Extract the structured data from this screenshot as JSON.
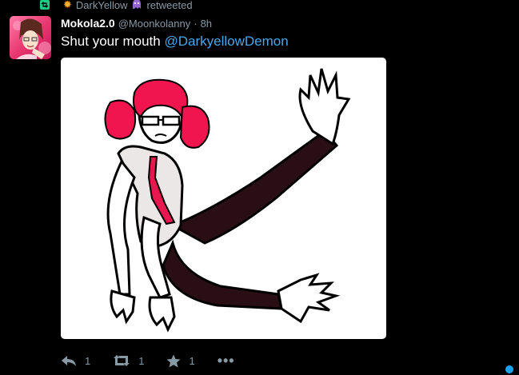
{
  "retweet": {
    "name": "DarkYellow",
    "label": "retweeted",
    "icon": "retweet-icon"
  },
  "tweet": {
    "display_name": "Mokola2.0",
    "handle": "@Moonkolanny",
    "separator": "·",
    "time": "8h",
    "text": "Shut your mouth ",
    "mention": "@DarkyellowDemon",
    "media_icon": "drawing-image"
  },
  "actions": {
    "reply_count": "1",
    "retweet_count": "1",
    "like_count": "1",
    "more_label": "•••"
  },
  "colors": {
    "background": "#000000",
    "text": "#ffffff",
    "muted": "#8899a6",
    "link": "#4ba6e8",
    "retweet_green": "#19cf86",
    "accent_blue": "#1da1f2"
  }
}
